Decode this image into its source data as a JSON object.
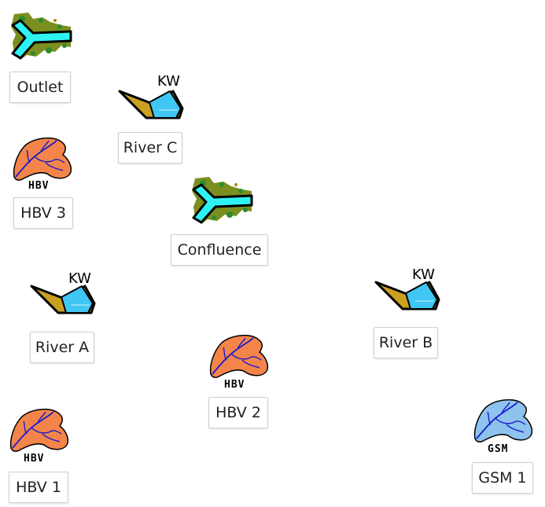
{
  "nodes": {
    "outlet": {
      "label": "Outlet"
    },
    "river_c": {
      "label": "River C",
      "tag": "KW"
    },
    "hbv3": {
      "label": "HBV 3",
      "model": "HBV"
    },
    "confluence": {
      "label": "Confluence"
    },
    "river_a": {
      "label": "River A",
      "tag": "KW"
    },
    "river_b": {
      "label": "River B",
      "tag": "KW"
    },
    "hbv2": {
      "label": "HBV 2",
      "model": "HBV"
    },
    "hbv1": {
      "label": "HBV 1",
      "model": "HBV"
    },
    "gsm1": {
      "label": "GSM 1",
      "model": "GSM"
    }
  },
  "colors": {
    "hbv_fill": "#f4854a",
    "gsm_fill": "#8ec3ee",
    "river_lines": "#1a1ad0",
    "channel_water": "#3fc6f3",
    "channel_bank": "#c9a020",
    "junction_water": "#2ef2f2",
    "junction_land": "#7a8f1f"
  },
  "icons": {
    "outlet": "river-junction-icon",
    "confluence": "river-junction-icon",
    "river": "river-channel-icon",
    "hbv": "catchment-icon",
    "gsm": "glacier-catchment-icon"
  }
}
